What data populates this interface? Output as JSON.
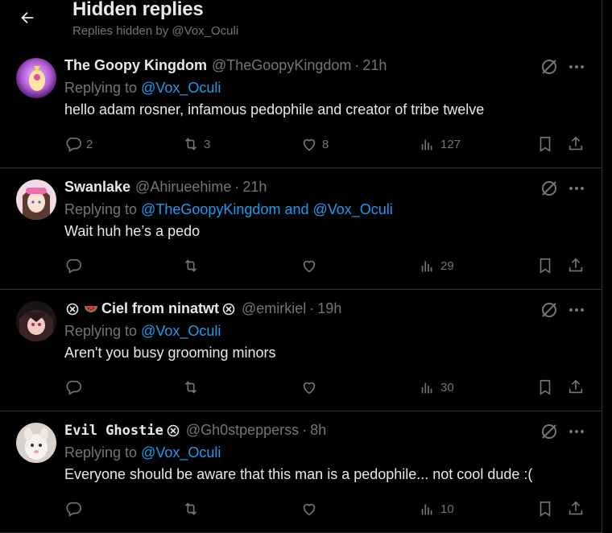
{
  "header": {
    "title": "Hidden replies",
    "subtitle": "Replies hidden by @Vox_Oculi",
    "back_icon": "arrow-left-icon"
  },
  "colors": {
    "background": "#000000",
    "text": "#e7e9ea",
    "muted": "#71767b",
    "link": "#1d9bf0",
    "border": "#2f3336"
  },
  "posts": [
    {
      "name": "The Goopy Kingdom",
      "handle": "@TheGoopyKingdom",
      "time": "21h",
      "replying_prefix": "Replying to",
      "replying_to": "@Vox_Oculi",
      "text": "hello adam rosner, infamous pedophile and creator of tribe twelve",
      "replies": "2",
      "reposts": "3",
      "likes": "8",
      "views": "127"
    },
    {
      "name": "Swanlake",
      "handle": "@Ahirueehime",
      "time": "21h",
      "replying_prefix": "Replying to",
      "replying_to": "@TheGoopyKingdom and @Vox_Oculi",
      "text": "Wait huh he’s a pedo",
      "replies": "",
      "reposts": "",
      "likes": "",
      "views": "29"
    },
    {
      "name_prefix_badge": "x-circle-badge",
      "name_emoji": "watermelon-emoji",
      "name": "Ciel from ninatwt",
      "name_suffix_badge": "x-circle-badge",
      "handle": "@emirkiel",
      "time": "19h",
      "replying_prefix": "Replying to",
      "replying_to": "@Vox_Oculi",
      "text": "Aren't you busy grooming minors",
      "replies": "",
      "reposts": "",
      "likes": "",
      "views": "30"
    },
    {
      "name": "Evil Ghostie",
      "name_suffix_badge": "x-circle-badge",
      "handle": "@Gh0stpepperss",
      "time": "8h",
      "replying_prefix": "Replying to",
      "replying_to": "@Vox_Oculi",
      "text": "Everyone should be aware that this man is a pedophile... not cool dude :(",
      "replies": "",
      "reposts": "",
      "likes": "",
      "views": "10"
    }
  ],
  "separator": "·"
}
